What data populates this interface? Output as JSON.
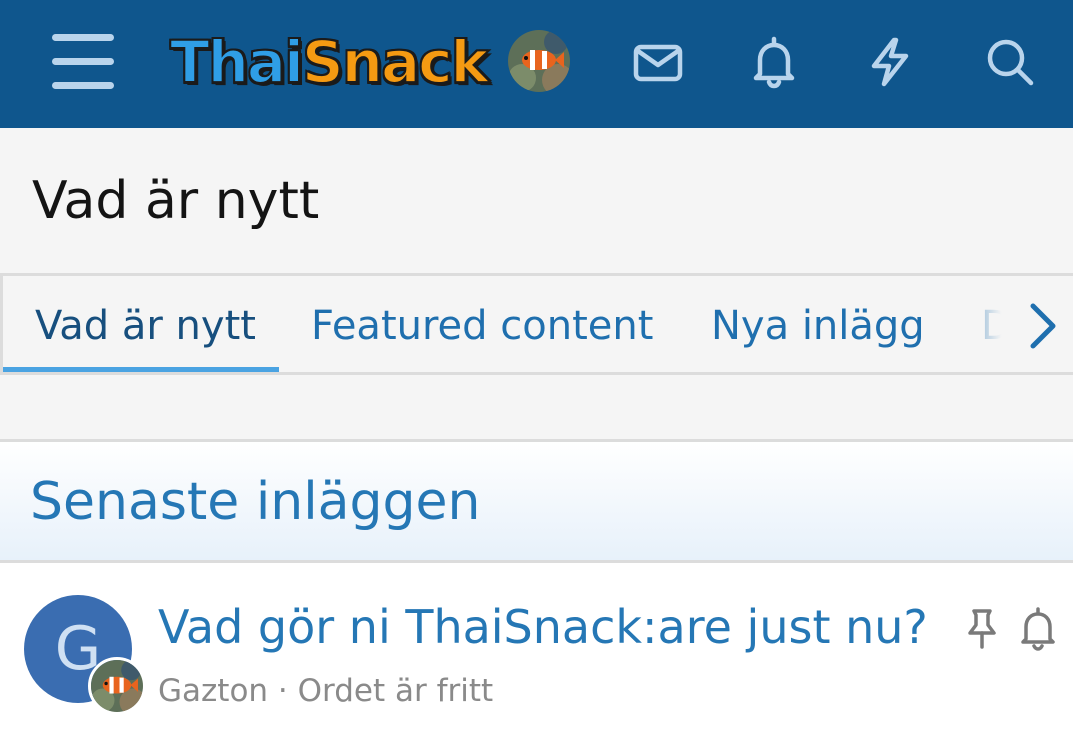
{
  "header": {
    "logo_part1": "Thai",
    "logo_part2": "Snack",
    "icons": [
      "menu-icon",
      "avatar",
      "mail-icon",
      "bell-icon",
      "bolt-icon",
      "search-icon"
    ],
    "colors": {
      "bar": "#0f568d",
      "icon": "#b9d4ec",
      "logo_blue": "#2f9ee6",
      "logo_orange": "#f59a12"
    }
  },
  "page": {
    "title": "Vad är nytt"
  },
  "tabs": {
    "items": [
      {
        "label": "Vad är nytt",
        "active": true
      },
      {
        "label": "Featured content",
        "active": false
      },
      {
        "label": "Nya inlägg",
        "active": false
      },
      {
        "label": "D",
        "active": false
      }
    ]
  },
  "section": {
    "title": "Senaste inläggen"
  },
  "threads": [
    {
      "avatar_letter": "G",
      "title": "Vad gör ni ThaiSnack:are just nu?",
      "author": "Gazton",
      "separator": "·",
      "forum": "Ordet är fritt",
      "pinned": true,
      "watched": true
    }
  ],
  "colors": {
    "accent": "#2577b5",
    "tab_underline": "#4aa3e2",
    "avatar_bg": "#3a6db1"
  }
}
